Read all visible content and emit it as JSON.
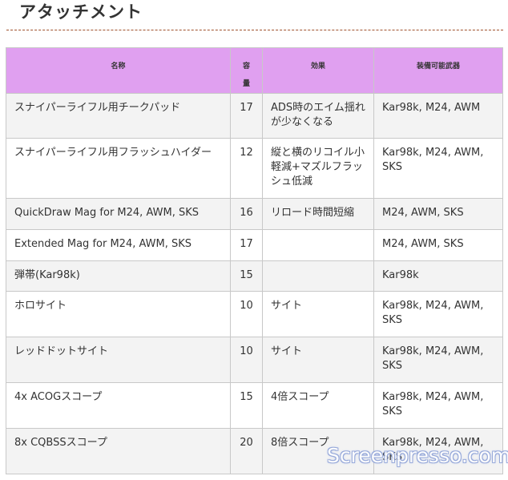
{
  "page_title": "アタッチメント",
  "table": {
    "headers": [
      "名称",
      "容量",
      "効果",
      "装備可能武器"
    ],
    "rows": [
      {
        "name": "スナイパーライフル用チークパッド",
        "capacity": "17",
        "effect": "ADS時のエイム揺れが少なくなる",
        "weapons": "Kar98k, M24, AWM"
      },
      {
        "name": "スナイパーライフル用フラッシュハイダー",
        "capacity": "12",
        "effect": "縦と横のリコイル小軽減+マズルフラッシュ低減",
        "weapons": "Kar98k, M24, AWM, SKS"
      },
      {
        "name": "QuickDraw Mag for M24, AWM, SKS",
        "capacity": "16",
        "effect": "リロード時間短縮",
        "weapons": "M24, AWM, SKS"
      },
      {
        "name": "Extended Mag for M24, AWM, SKS",
        "capacity": "17",
        "effect": "",
        "weapons": "M24, AWM, SKS"
      },
      {
        "name": "弾帯(Kar98k)",
        "capacity": "15",
        "effect": "",
        "weapons": "Kar98k"
      },
      {
        "name": "ホロサイト",
        "capacity": "10",
        "effect": "サイト",
        "weapons": "Kar98k, M24, AWM, SKS"
      },
      {
        "name": "レッドドットサイト",
        "capacity": "10",
        "effect": "サイト",
        "weapons": "Kar98k, M24, AWM, SKS"
      },
      {
        "name": "4x ACOGスコープ",
        "capacity": "15",
        "effect": "4倍スコープ",
        "weapons": "Kar98k, M24, AWM, SKS"
      },
      {
        "name": "8x CQBSSスコープ",
        "capacity": "20",
        "effect": "8倍スコープ",
        "weapons": "Kar98k, M24, AWM, SKS"
      }
    ]
  },
  "watermark": "Screenpresso.com",
  "colors": {
    "header_bg": "#e0a0f0",
    "row_alt_bg": "#f3f3f3",
    "divider": "#a0522d"
  }
}
